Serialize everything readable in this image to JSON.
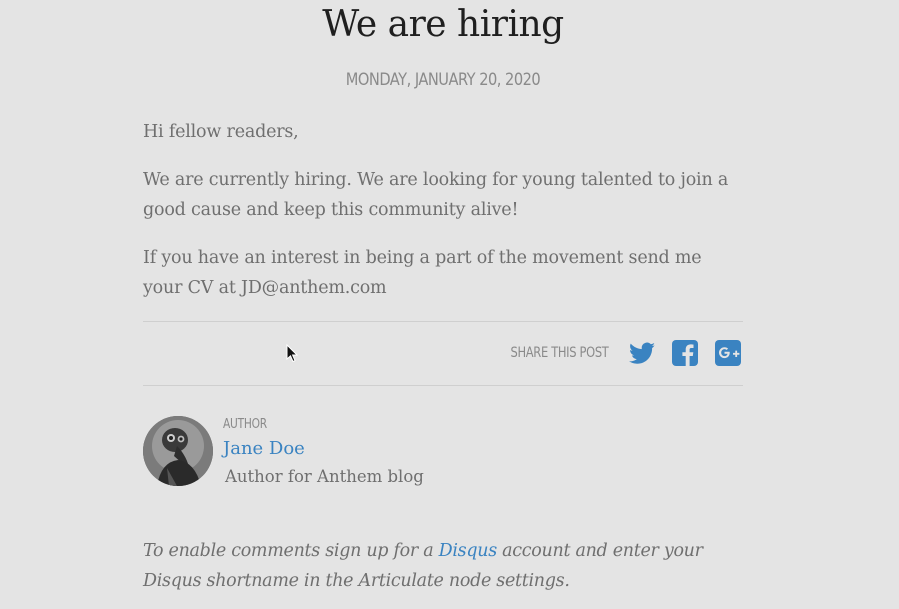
{
  "post": {
    "title": "We are hiring",
    "date": "MONDAY, JANUARY 20, 2020",
    "paragraphs": [
      "Hi fellow readers,",
      "We are currently hiring. We are looking for young talented to join a good cause and keep this community alive!",
      "If you have an interest in being a part of the movement send me your CV at JD@anthem.com"
    ]
  },
  "share": {
    "label": "SHARE THIS POST",
    "buttons": [
      {
        "icon": "twitter-icon",
        "color": "#3a83c1"
      },
      {
        "icon": "facebook-icon",
        "color": "#3a83c1"
      },
      {
        "icon": "google-plus-icon",
        "color": "#3a83c1"
      }
    ]
  },
  "author": {
    "kicker": "AUTHOR",
    "name": "Jane Doe",
    "bio": "Author for Anthem blog",
    "avatar_icon": "plague-doctor-avatar"
  },
  "comments": {
    "prefix": "To enable comments sign up for a ",
    "link": "Disqus",
    "suffix": " account and enter your Disqus shortname in the Articulate node settings."
  },
  "colors": {
    "background": "#e4e4e4",
    "accent": "#3a83c1",
    "title": "#1f1f1f",
    "body_text": "#6f6f6f",
    "muted": "#8a8a8a"
  }
}
